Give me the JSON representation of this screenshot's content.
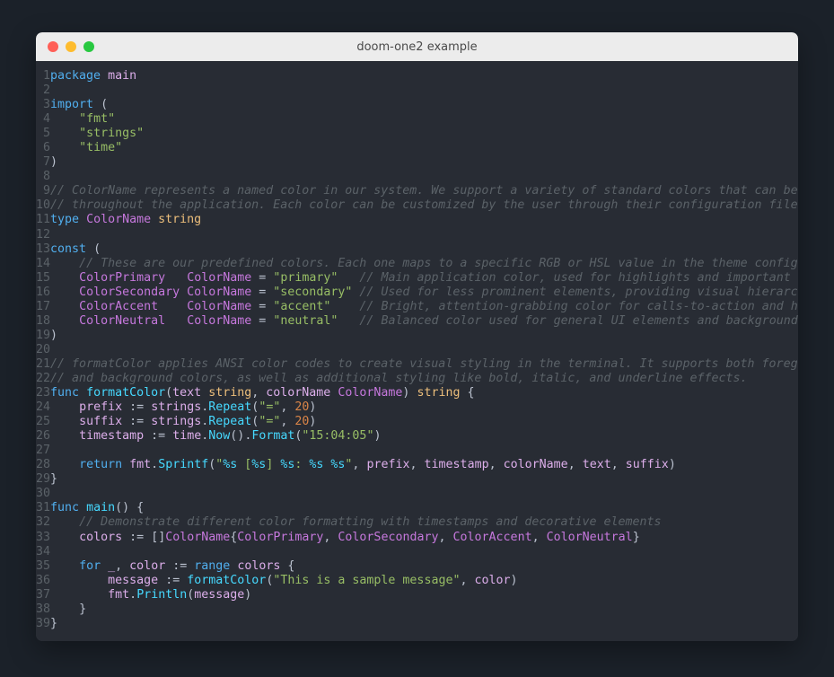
{
  "window": {
    "title": "doom-one2 example",
    "controls": [
      {
        "name": "close-button",
        "color": "#ff5f57"
      },
      {
        "name": "minimize-button",
        "color": "#febc2e"
      },
      {
        "name": "maximize-button",
        "color": "#28c840"
      }
    ]
  },
  "theme": {
    "name": "doom-one2",
    "page_background": "#1b2129",
    "editor_background": "#282c34",
    "titlebar_background": "#ececec",
    "foreground": "#bbc2cf",
    "line_number": "#5b6268",
    "keyword": "#51afef",
    "type": "#c678dd",
    "builtin_type": "#ecbe7b",
    "string": "#98be65",
    "format_spec": "#46d9ff",
    "function": "#46d9ff",
    "variable": "#dcaeea",
    "comment": "#5b6268",
    "number": "#da8548"
  },
  "editor": {
    "language": "go",
    "first_line": 1,
    "last_line": 39,
    "lines": [
      {
        "n": 1,
        "text": "package main"
      },
      {
        "n": 2,
        "text": ""
      },
      {
        "n": 3,
        "text": "import ("
      },
      {
        "n": 4,
        "text": "    \"fmt\""
      },
      {
        "n": 5,
        "text": "    \"strings\""
      },
      {
        "n": 6,
        "text": "    \"time\""
      },
      {
        "n": 7,
        "text": ")"
      },
      {
        "n": 8,
        "text": ""
      },
      {
        "n": 9,
        "text": "// ColorName represents a named color in our system. We support a variety of standard colors that can be used"
      },
      {
        "n": 10,
        "text": "// throughout the application. Each color can be customized by the user through their configuration file."
      },
      {
        "n": 11,
        "text": "type ColorName string"
      },
      {
        "n": 12,
        "text": ""
      },
      {
        "n": 13,
        "text": "const ("
      },
      {
        "n": 14,
        "text": "    // These are our predefined colors. Each one maps to a specific RGB or HSL value in the theme configuration."
      },
      {
        "n": 15,
        "text": "    ColorPrimary   ColorName = \"primary\"   // Main application color, used for highlights and important UI elements"
      },
      {
        "n": 16,
        "text": "    ColorSecondary ColorName = \"secondary\" // Used for less prominent elements, providing visual hierarchy"
      },
      {
        "n": 17,
        "text": "    ColorAccent    ColorName = \"accent\"    // Bright, attention-grabbing color for calls-to-action and highlights"
      },
      {
        "n": 18,
        "text": "    ColorNeutral   ColorName = \"neutral\"   // Balanced color used for general UI elements and backgrounds"
      },
      {
        "n": 19,
        "text": ")"
      },
      {
        "n": 20,
        "text": ""
      },
      {
        "n": 21,
        "text": "// formatColor applies ANSI color codes to create visual styling in the terminal. It supports both foreground"
      },
      {
        "n": 22,
        "text": "// and background colors, as well as additional styling like bold, italic, and underline effects."
      },
      {
        "n": 23,
        "text": "func formatColor(text string, colorName ColorName) string {"
      },
      {
        "n": 24,
        "text": "    prefix := strings.Repeat(\"=\", 20)"
      },
      {
        "n": 25,
        "text": "    suffix := strings.Repeat(\"=\", 20)"
      },
      {
        "n": 26,
        "text": "    timestamp := time.Now().Format(\"15:04:05\")"
      },
      {
        "n": 27,
        "text": ""
      },
      {
        "n": 28,
        "text": "    return fmt.Sprintf(\"%s [%s] %s: %s %s\", prefix, timestamp, colorName, text, suffix)"
      },
      {
        "n": 29,
        "text": "}"
      },
      {
        "n": 30,
        "text": ""
      },
      {
        "n": 31,
        "text": "func main() {"
      },
      {
        "n": 32,
        "text": "    // Demonstrate different color formatting with timestamps and decorative elements"
      },
      {
        "n": 33,
        "text": "    colors := []ColorName{ColorPrimary, ColorSecondary, ColorAccent, ColorNeutral}"
      },
      {
        "n": 34,
        "text": ""
      },
      {
        "n": 35,
        "text": "    for _, color := range colors {"
      },
      {
        "n": 36,
        "text": "        message := formatColor(\"This is a sample message\", color)"
      },
      {
        "n": 37,
        "text": "        fmt.Println(message)"
      },
      {
        "n": 38,
        "text": "    }"
      },
      {
        "n": 39,
        "text": "}"
      }
    ]
  }
}
